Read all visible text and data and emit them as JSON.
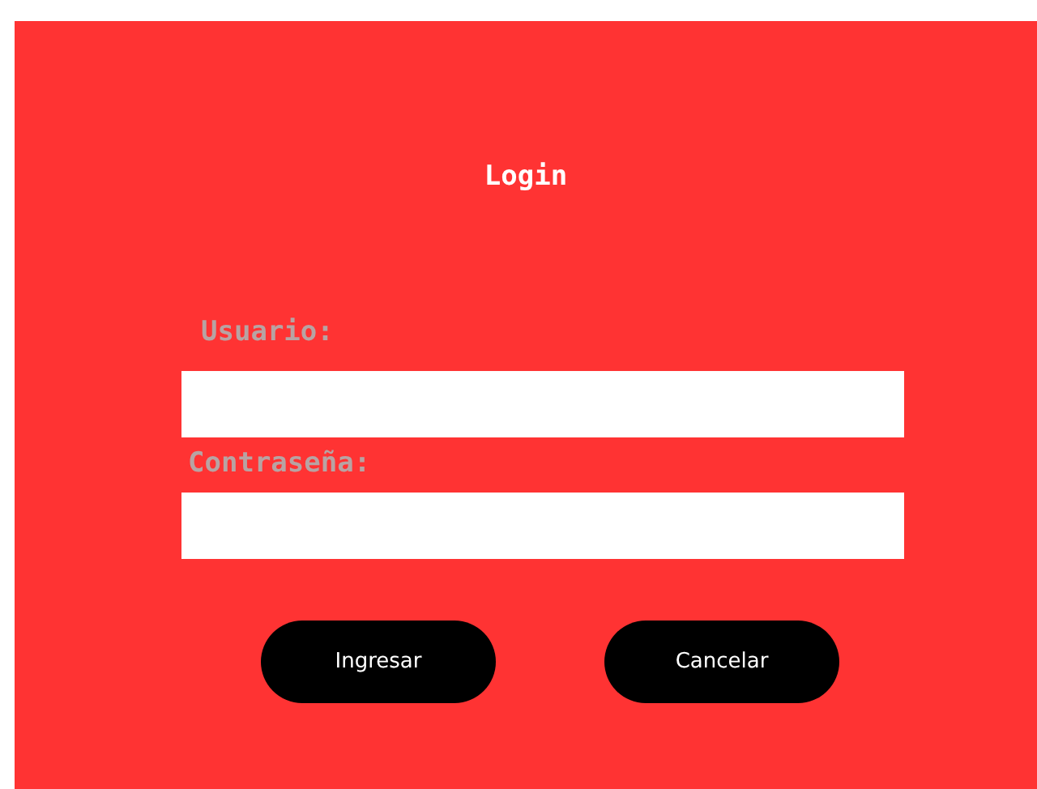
{
  "title": "Login",
  "fields": [
    {
      "label": "Usuario:"
    },
    {
      "label": "Contraseña:"
    }
  ],
  "buttons": [
    "Ingresar",
    "Cancelar"
  ]
}
